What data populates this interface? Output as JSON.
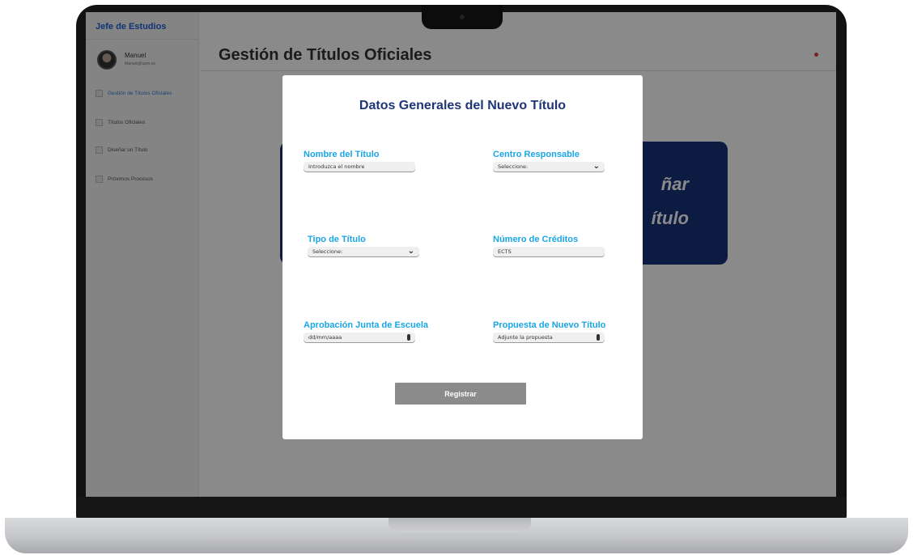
{
  "sidebar": {
    "brand": "Jefe de Estudios",
    "user": {
      "name": "Manuel",
      "email": "Manuel@upm.es"
    },
    "items": [
      {
        "label": "Gestión de Títulos Oficiales"
      },
      {
        "label": "Títulos Oficiales"
      },
      {
        "label": "Diseñar un Título"
      },
      {
        "label": "Próximos Procesos"
      }
    ]
  },
  "header": {
    "title": "Gestión de Títulos Oficiales"
  },
  "background_card": {
    "line1": "ñar",
    "line2": "ítulo"
  },
  "modal": {
    "title": "Datos Generales del Nuevo Título",
    "fields": {
      "nombre": {
        "label": "Nombre del Título",
        "placeholder": "Introduzca el nombre"
      },
      "centro": {
        "label": "Centro Responsable",
        "value": "Seleccione:"
      },
      "tipo": {
        "label": "Tipo de Título",
        "value": "Seleccione:"
      },
      "creditos": {
        "label": "Número de Créditos",
        "placeholder": "ECTS"
      },
      "aprobacion": {
        "label": "Aprobación Junta de Escuela",
        "placeholder": "dd/mm/aaaa"
      },
      "propuesta": {
        "label": "Propuesta de Nuevo Título",
        "placeholder": "Adjunte la propuesta"
      }
    },
    "submit_label": "Registrar"
  },
  "colors": {
    "modal_title": "#1f3577",
    "field_label": "#1aa5e6",
    "brand": "#1e5fd8",
    "card": "#17327a",
    "button": "#8b8b8b"
  },
  "icons": [
    "chevron-down-icon",
    "paperclip-icon",
    "notification-icon"
  ]
}
